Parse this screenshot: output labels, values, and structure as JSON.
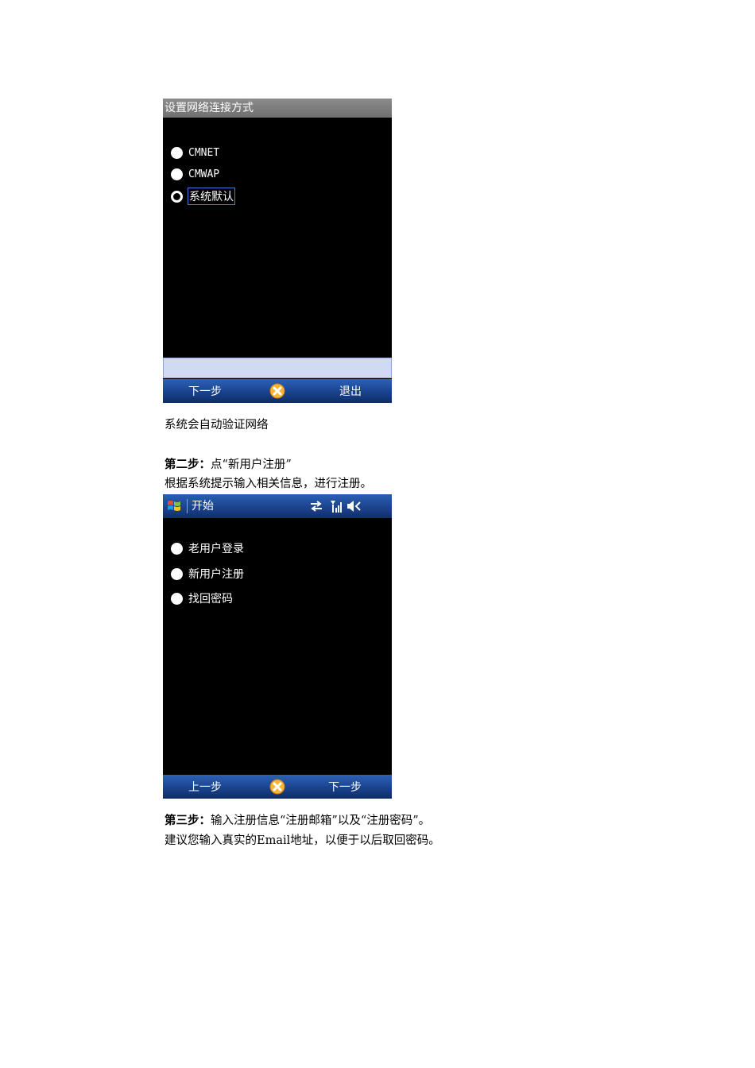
{
  "screen1": {
    "title": "设置网络连接方式",
    "options": [
      {
        "label": "CMNET",
        "selected": false
      },
      {
        "label": "CMWAP",
        "selected": false
      },
      {
        "label": "系统默认",
        "selected": true
      }
    ],
    "softkeys": {
      "left": "下一步",
      "right": "退出"
    }
  },
  "caption1": "系统会自动验证网络",
  "step2": {
    "label": "第二步：",
    "text": "点“新用户注册”",
    "desc": "根据系统提示输入相关信息，进行注册。"
  },
  "screen2": {
    "title": "开始",
    "options": [
      {
        "label": "老用户登录"
      },
      {
        "label": "新用户注册"
      },
      {
        "label": "找回密码"
      }
    ],
    "softkeys": {
      "left": "上一步",
      "right": "下一步"
    }
  },
  "step3": {
    "label": "第三步：",
    "text": "输入注册信息“注册邮箱”以及“注册密码”。",
    "desc": "建议您输入真实的Email地址，以便于以后取回密码。"
  },
  "colors": {
    "softkey_bar": "#1b4590",
    "input_bar": "#d0dbf3",
    "screen_bg": "#000000"
  }
}
